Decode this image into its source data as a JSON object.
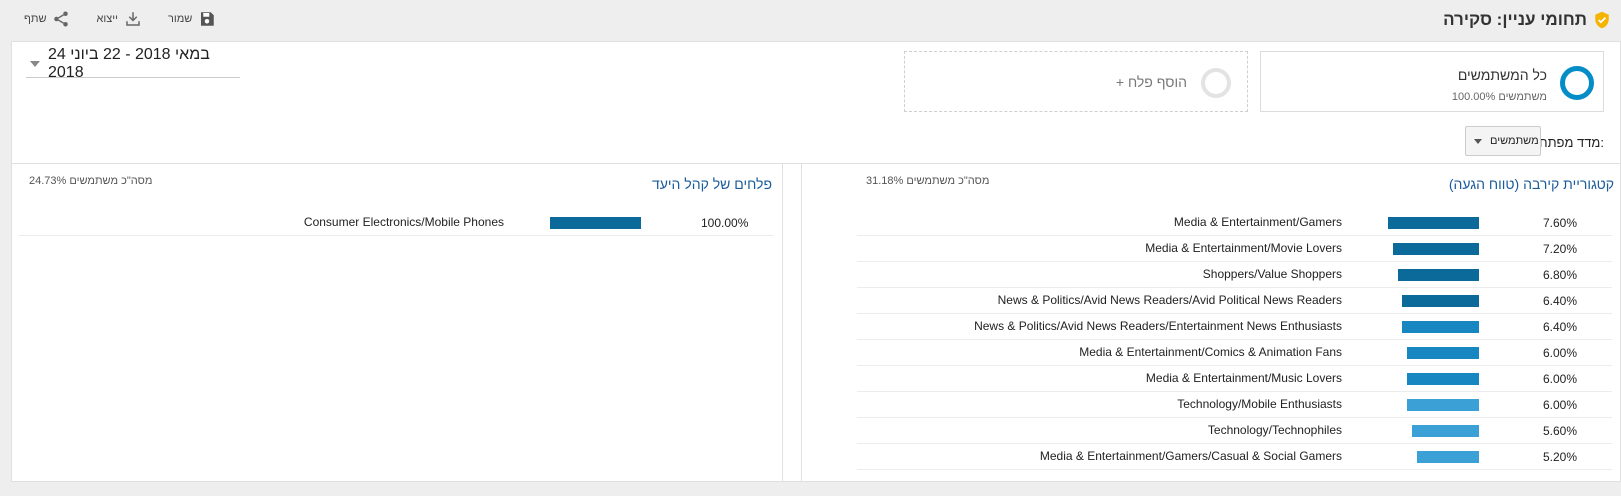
{
  "header": {
    "title": "תחומי עניין: סקירה",
    "actions": [
      {
        "label": "שמור",
        "icon": "save-icon"
      },
      {
        "label": "ייצוא",
        "icon": "download-icon"
      },
      {
        "label": "שתף",
        "icon": "share-icon"
      }
    ]
  },
  "segments": {
    "all_users": {
      "name": "כל המשתמשים",
      "sub": "100.00% משתמשים"
    },
    "add_label": "+ הוסף פלח"
  },
  "date_range": "24 במאי 2018 - 22 ביוני 2018",
  "key_metric": {
    "label": "מדד מפתח:",
    "value": "משתמשים"
  },
  "colors": {
    "accent": "#058dc7",
    "link": "#1a5b9b",
    "bar_dark": "#0b6a99",
    "bar_light": "#3aa0d6"
  },
  "affinity": {
    "title": "קטגוריית קירבה (טווח הגעה)",
    "total": "31.18% מסה\"כ משתמשים",
    "rows": [
      {
        "name": "Media & Entertainment/Gamers",
        "value": "7.60%",
        "pct": 7.6
      },
      {
        "name": "Media & Entertainment/Movie Lovers",
        "value": "7.20%",
        "pct": 7.2
      },
      {
        "name": "Shoppers/Value Shoppers",
        "value": "6.80%",
        "pct": 6.8
      },
      {
        "name": "News & Politics/Avid News Readers/Avid Political News Readers",
        "value": "6.40%",
        "pct": 6.4
      },
      {
        "name": "News & Politics/Avid News Readers/Entertainment News Enthusiasts",
        "value": "6.40%",
        "pct": 6.4
      },
      {
        "name": "Media & Entertainment/Comics & Animation Fans",
        "value": "6.00%",
        "pct": 6.0
      },
      {
        "name": "Media & Entertainment/Music Lovers",
        "value": "6.00%",
        "pct": 6.0
      },
      {
        "name": "Technology/Mobile Enthusiasts",
        "value": "6.00%",
        "pct": 6.0
      },
      {
        "name": "Technology/Technophiles",
        "value": "5.60%",
        "pct": 5.6
      },
      {
        "name": "Media & Entertainment/Gamers/Casual & Social Gamers",
        "value": "5.20%",
        "pct": 5.2
      }
    ]
  },
  "in_market": {
    "title": "פלחים של קהל היעד",
    "total": "24.73% מסה\"כ משתמשים",
    "rows": [
      {
        "name": "Consumer Electronics/Mobile Phones",
        "value": "100.00%",
        "pct": 100.0
      }
    ]
  }
}
